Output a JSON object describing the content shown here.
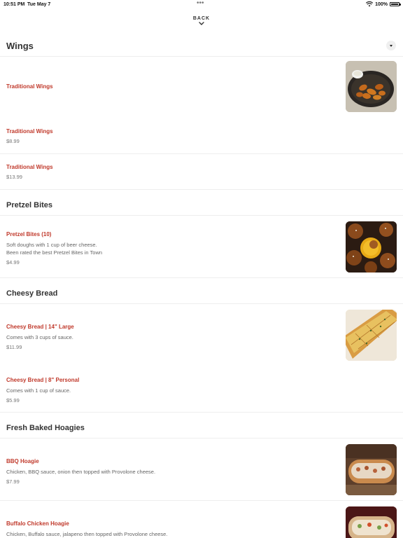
{
  "status_bar": {
    "time": "10:51 PM",
    "date": "Tue May 7",
    "battery": "100%"
  },
  "nav": {
    "back_label": "BACK"
  },
  "sections": {
    "wings": {
      "title": "Wings",
      "items": [
        {
          "name": "Traditional Wings",
          "price": ""
        },
        {
          "name": "Traditional Wings",
          "price": "$8.99"
        },
        {
          "name": "Traditional Wings",
          "price": "$13.99"
        }
      ]
    },
    "pretzel": {
      "title": "Pretzel Bites",
      "items": [
        {
          "name": "Pretzel Bites (10)",
          "desc_line1": "Soft doughs with 1 cup of beer cheese.",
          "desc_line2": "Been rated the best Pretzel Bites in Town",
          "price": "$4.99"
        }
      ]
    },
    "cheesy": {
      "title": "Cheesy Bread",
      "items": [
        {
          "name": "Cheesy Bread | 14\" Large",
          "desc": "Comes with 3 cups of sauce.",
          "price": "$11.99"
        },
        {
          "name": "Cheesy Bread | 8\" Personal",
          "desc": "Comes with 1 cup of sauce.",
          "price": "$5.99"
        }
      ]
    },
    "hoagies": {
      "title": "Fresh Baked Hoagies",
      "items": [
        {
          "name": "BBQ Hoagie",
          "desc": "Chicken, BBQ sauce, onion then topped with Provolone cheese.",
          "price": "$7.99"
        },
        {
          "name": "Buffalo Chicken Hoagie",
          "desc": "Chicken, Buffalo sauce, jalapeno then topped with Provolone cheese."
        }
      ]
    }
  },
  "colors": {
    "item_name": "#c0392b",
    "text": "#333333",
    "muted": "#777777",
    "divider": "#eeeeee"
  },
  "icons": [
    "wifi-icon",
    "battery-icon",
    "chevron-down-icon",
    "collapse-caret-icon"
  ]
}
